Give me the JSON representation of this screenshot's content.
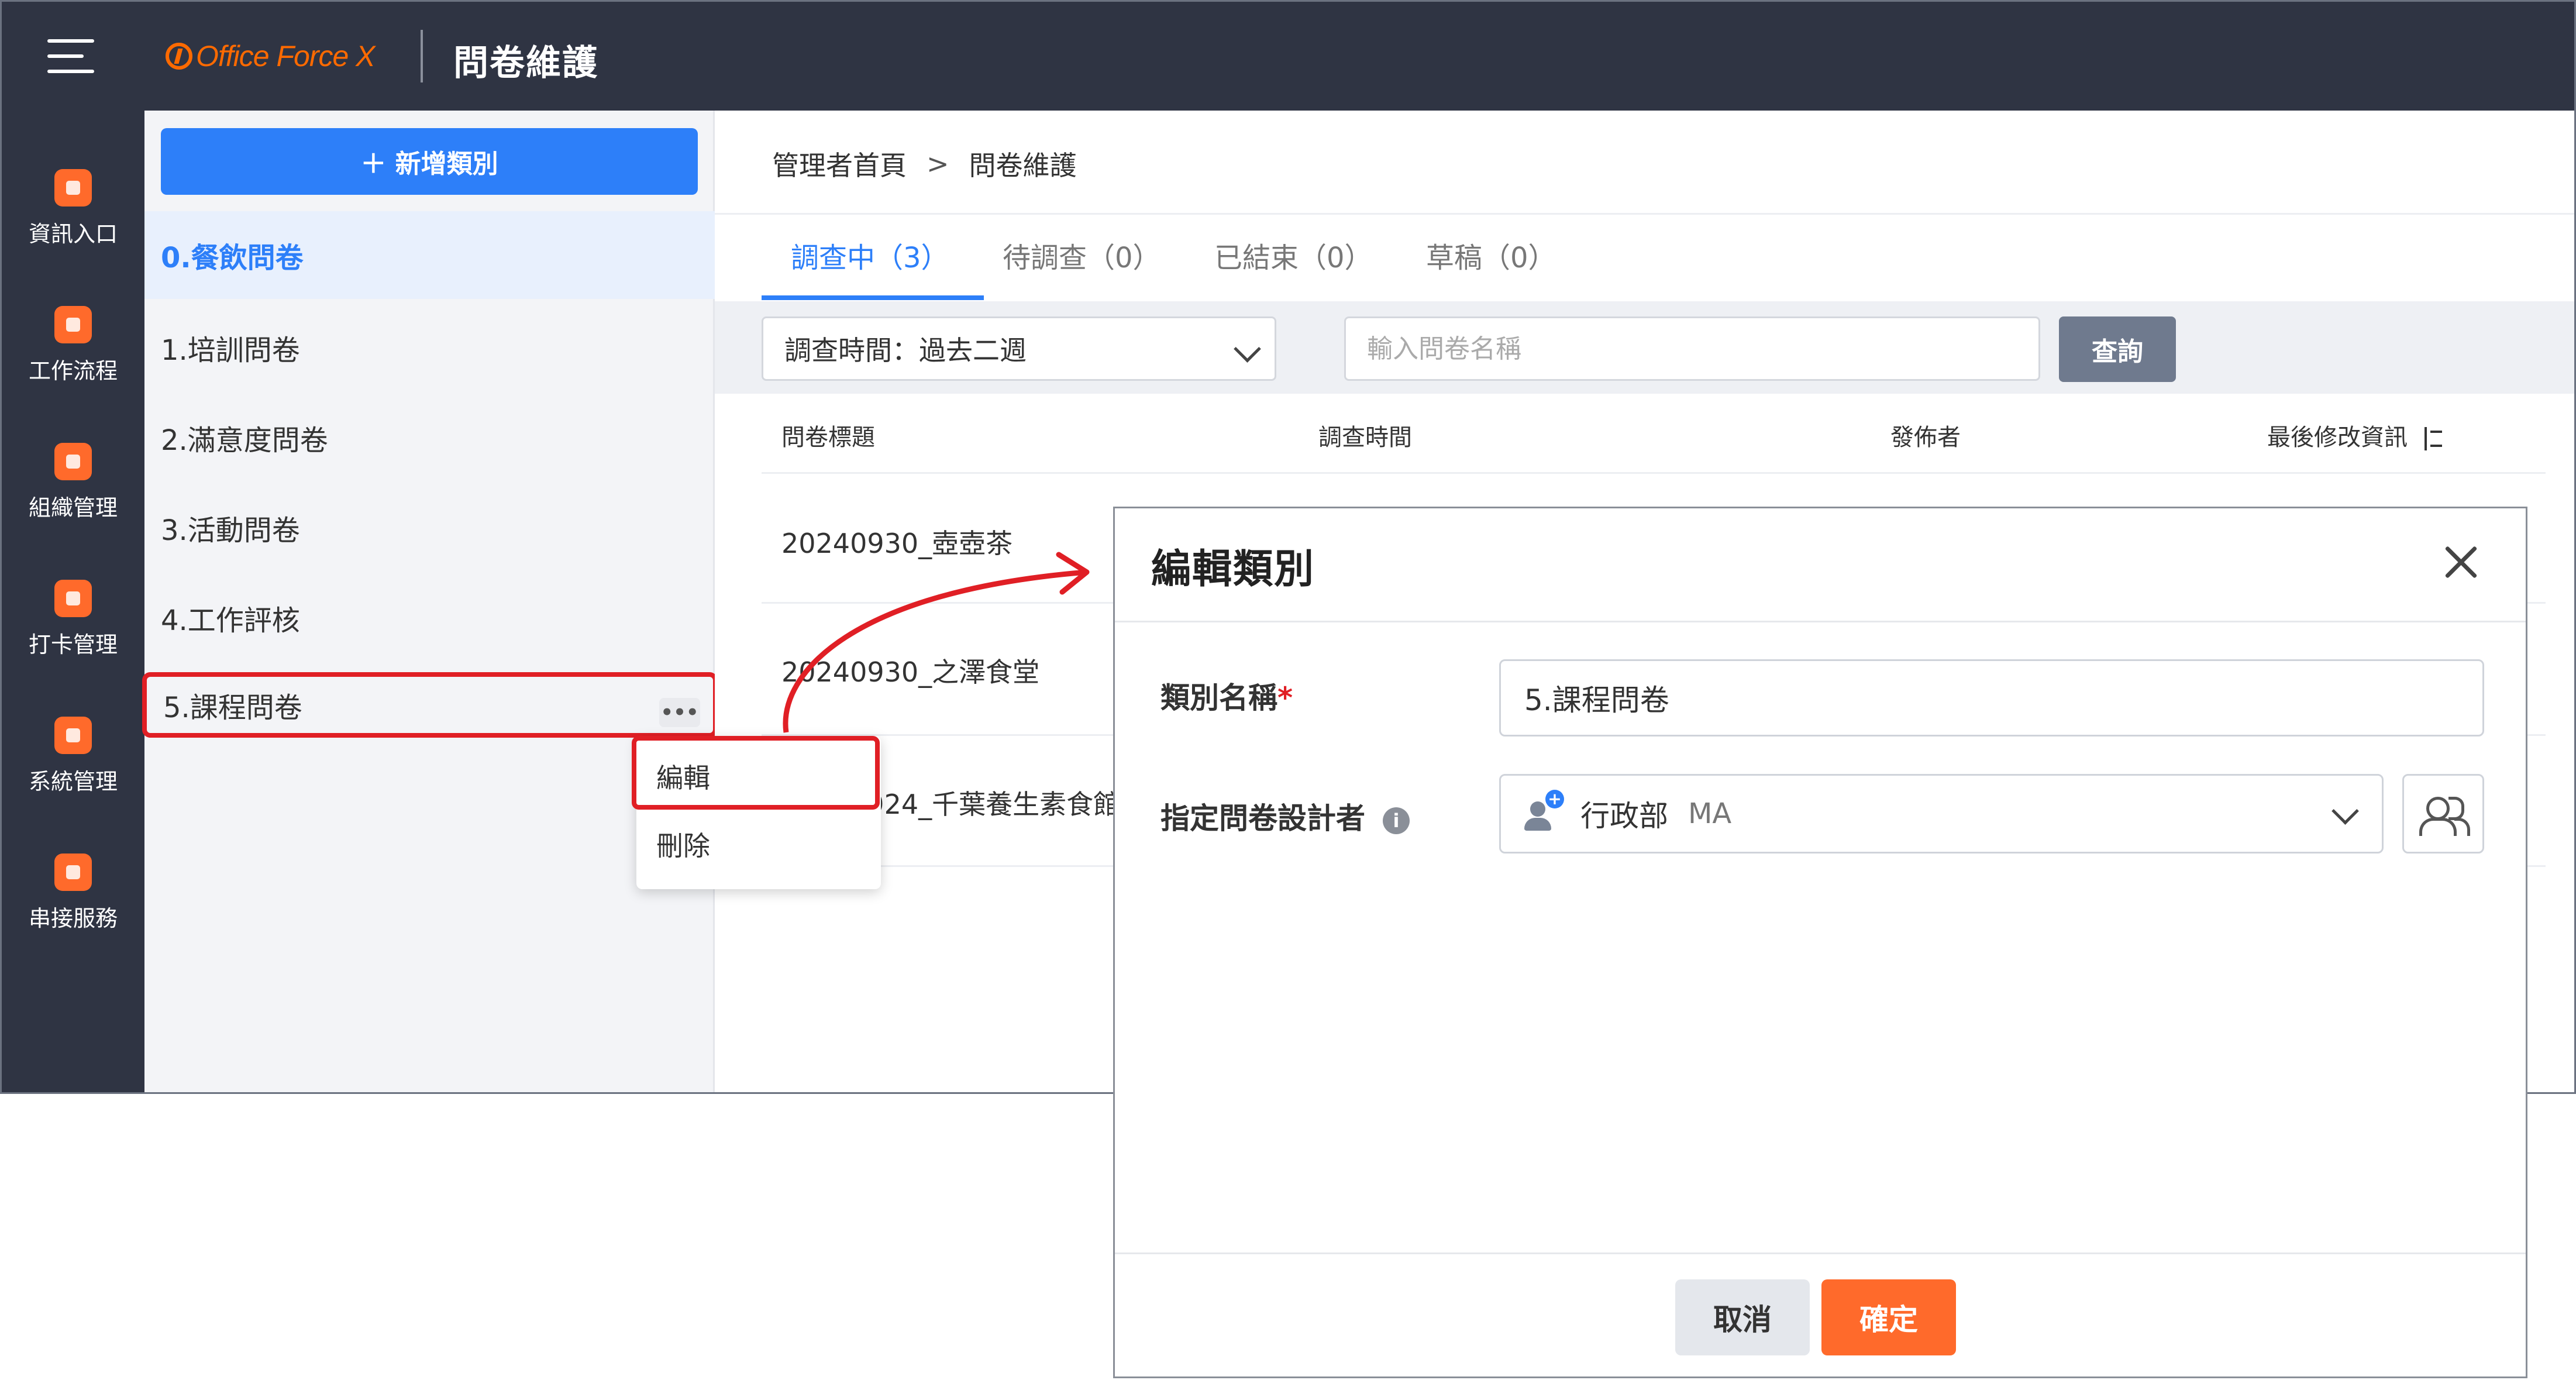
{
  "header": {
    "logo_text": "Office Force X",
    "page_title": "問卷維護",
    "menu_icon": "hamburger-icon"
  },
  "leftnav": {
    "items": [
      {
        "label": "資訊入口",
        "icon": "dashboard-icon"
      },
      {
        "label": "工作流程",
        "icon": "clipboard-check-icon"
      },
      {
        "label": "組織管理",
        "icon": "building-icon"
      },
      {
        "label": "打卡管理",
        "icon": "location-pin-icon"
      },
      {
        "label": "系統管理",
        "icon": "gear-icon"
      },
      {
        "label": "串接服務",
        "icon": "plug-icon"
      }
    ],
    "accent_color": "#ff6a2b"
  },
  "categories": {
    "add_button_label": "＋ 新增類別",
    "items": [
      "0.餐飲問卷",
      "1.培訓問卷",
      "2.滿意度問卷",
      "3.活動問卷",
      "4.工作評核",
      "5.課程問卷"
    ],
    "active_index": 0,
    "more_label": "•••"
  },
  "context_menu": {
    "items": [
      "編輯",
      "刪除"
    ]
  },
  "main": {
    "breadcrumb": [
      "管理者首頁",
      "問卷維護"
    ],
    "breadcrumb_sep": ">",
    "tabs": [
      "調查中（3）",
      "待調查（0）",
      "已結束（0）",
      "草稿（0）"
    ],
    "active_tab": 0,
    "filter": {
      "time_select": "調查時間：過去二週",
      "search_placeholder": "輸入問卷名稱",
      "query_label": "查詢"
    },
    "table": {
      "headers": [
        "問卷標題",
        "調查時間",
        "發佈者",
        "最後修改資訊"
      ],
      "rows": [
        "20240930_壺壺茶",
        "20240930_之澤食堂",
        "20240924_千葉養生素食館"
      ]
    }
  },
  "dialog": {
    "title": "編輯類別",
    "fields": {
      "name_label": "類別名稱",
      "required_mark": "*",
      "name_value": "5.課程問卷",
      "designer_label": "指定問卷設計者",
      "designer_dept": "行政部",
      "designer_user": "MA"
    },
    "cancel_label": "取消",
    "confirm_label": "確定"
  },
  "colors": {
    "primary": "#2d7ff9",
    "orange": "#ff6a2b",
    "sidebar": "#2f3443",
    "highlight": "#e01f25"
  }
}
